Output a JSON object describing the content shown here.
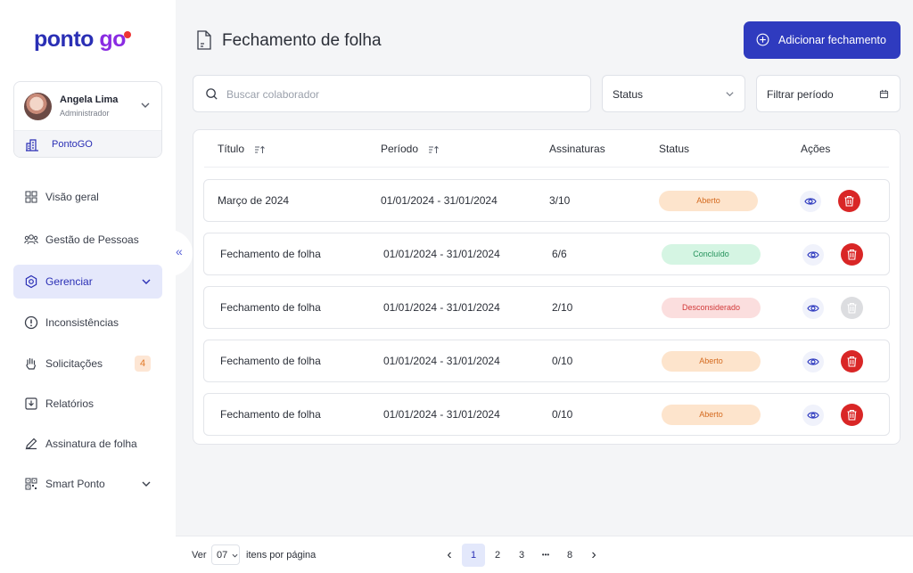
{
  "brand": {
    "name_part1": "ponto ",
    "name_part2": "go"
  },
  "user": {
    "name": "Angela Lima",
    "role": "Administrador",
    "company": "PontoGO"
  },
  "nav": {
    "items": [
      {
        "label": "Visão geral",
        "icon": "grid-icon"
      },
      {
        "label": "Gestão de Pessoas",
        "icon": "people-icon"
      },
      {
        "label": "Gerenciar",
        "icon": "gear-icon",
        "active": true
      },
      {
        "label": "Inconsistências",
        "icon": "alert-icon"
      },
      {
        "label": "Solicitações",
        "icon": "hand-icon",
        "badge": "4"
      },
      {
        "label": "Relatórios",
        "icon": "download-icon"
      },
      {
        "label": "Assinatura de folha",
        "icon": "pen-icon"
      },
      {
        "label": "Smart Ponto",
        "icon": "qr-icon"
      }
    ],
    "collapse_glyph": "«"
  },
  "header": {
    "title": "Fechamento de folha",
    "add_button": "Adicionar fechamento"
  },
  "filters": {
    "search_placeholder": "Buscar colaborador",
    "status_label": "Status",
    "period_label": "Filtrar período"
  },
  "table": {
    "columns": [
      "Título",
      "Período",
      "Assinaturas",
      "Status",
      "Ações"
    ],
    "rows": [
      {
        "title": "Março de 2024",
        "period": "01/01/2024 - 31/01/2024",
        "signatures": "3/10",
        "status": "Aberto",
        "status_kind": "aberto",
        "delete_enabled": true
      },
      {
        "title": "Fechamento de folha",
        "period": "01/01/2024 - 31/01/2024",
        "signatures": "6/6",
        "status": "Concluído",
        "status_kind": "concluido",
        "delete_enabled": true
      },
      {
        "title": "Fechamento de folha",
        "period": "01/01/2024 - 31/01/2024",
        "signatures": "2/10",
        "status": "Desconsiderado",
        "status_kind": "desc",
        "delete_enabled": false
      },
      {
        "title": "Fechamento de folha",
        "period": "01/01/2024 - 31/01/2024",
        "signatures": "0/10",
        "status": "Aberto",
        "status_kind": "aberto",
        "delete_enabled": true
      },
      {
        "title": "Fechamento de folha",
        "period": "01/01/2024 - 31/01/2024",
        "signatures": "0/10",
        "status": "Aberto",
        "status_kind": "aberto",
        "delete_enabled": true
      }
    ]
  },
  "pagination": {
    "ver_label": "Ver",
    "per_page": "07",
    "items_label": "itens por página",
    "prev": "‹",
    "pages": [
      "1",
      "2",
      "3",
      "•••",
      "8"
    ],
    "current": "1",
    "next": "›"
  },
  "colors": {
    "primary": "#2f3bbf",
    "danger": "#d92626",
    "accent_bg": "#e5e8fb"
  }
}
